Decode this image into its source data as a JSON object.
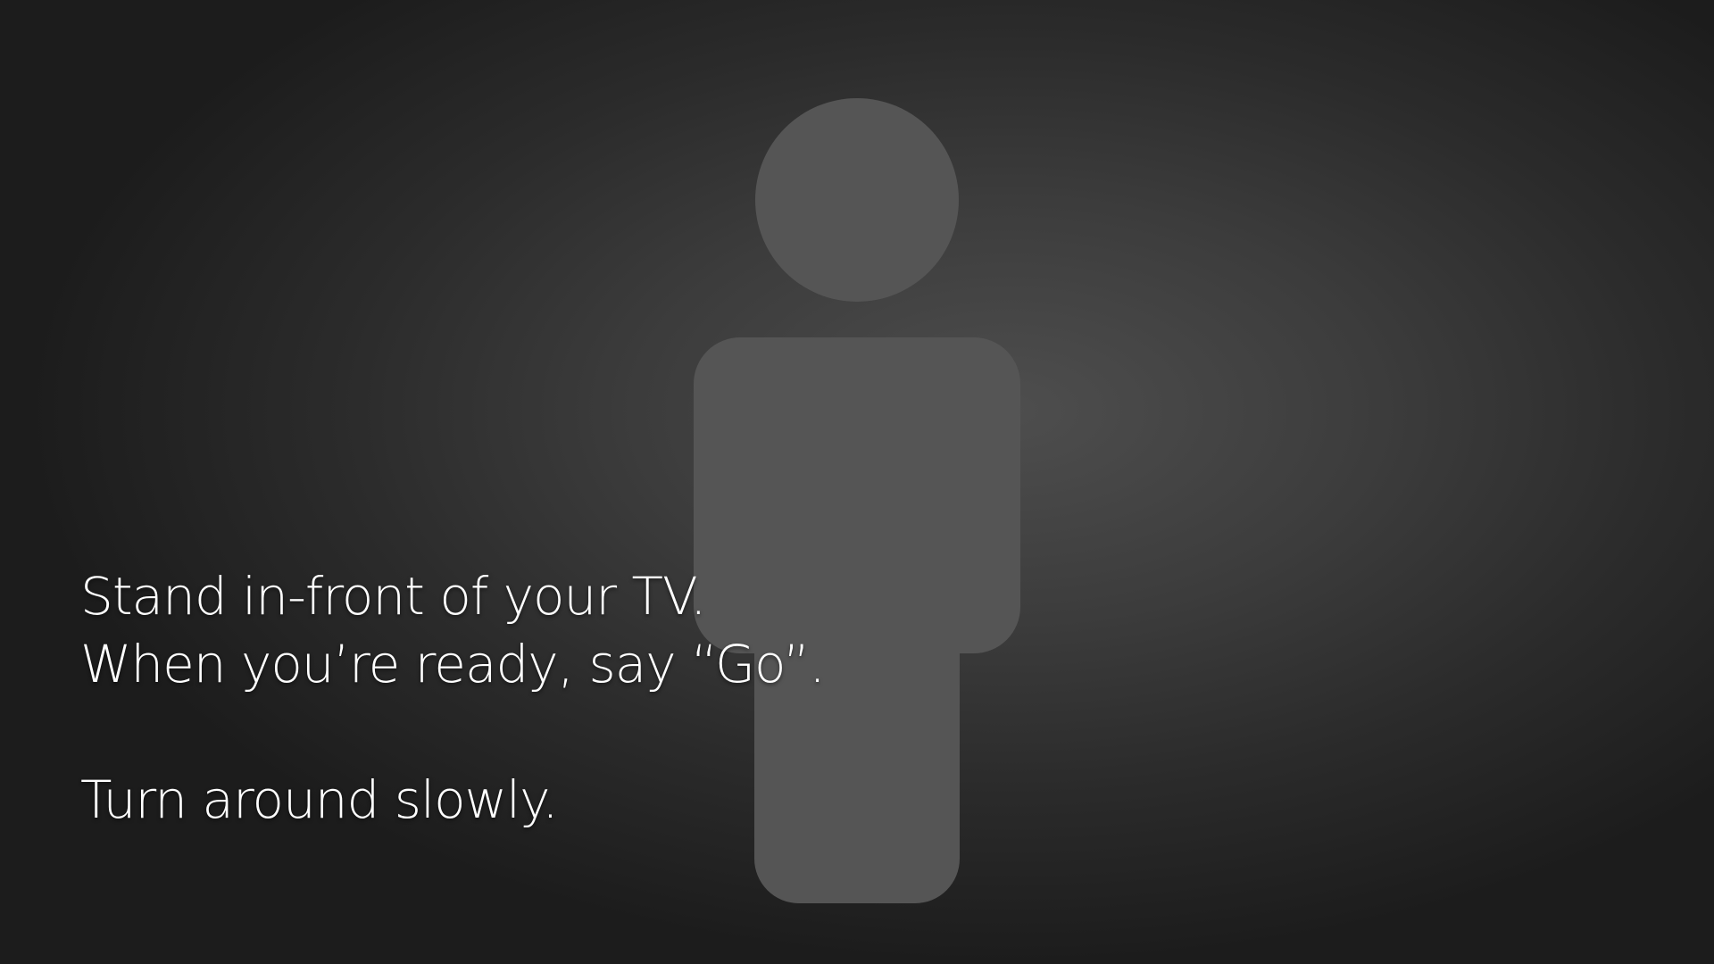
{
  "instructions": {
    "line1": "Stand in-front of your TV.",
    "line2": "When you’re ready, say “Go”.",
    "line3": "Turn around slowly."
  },
  "figure": {
    "icon": "person-silhouette-icon",
    "color": "#555555"
  },
  "colors": {
    "background_center": "#4e4e4e",
    "background_edge": "#1c1c1c",
    "text": "#ffffff"
  }
}
